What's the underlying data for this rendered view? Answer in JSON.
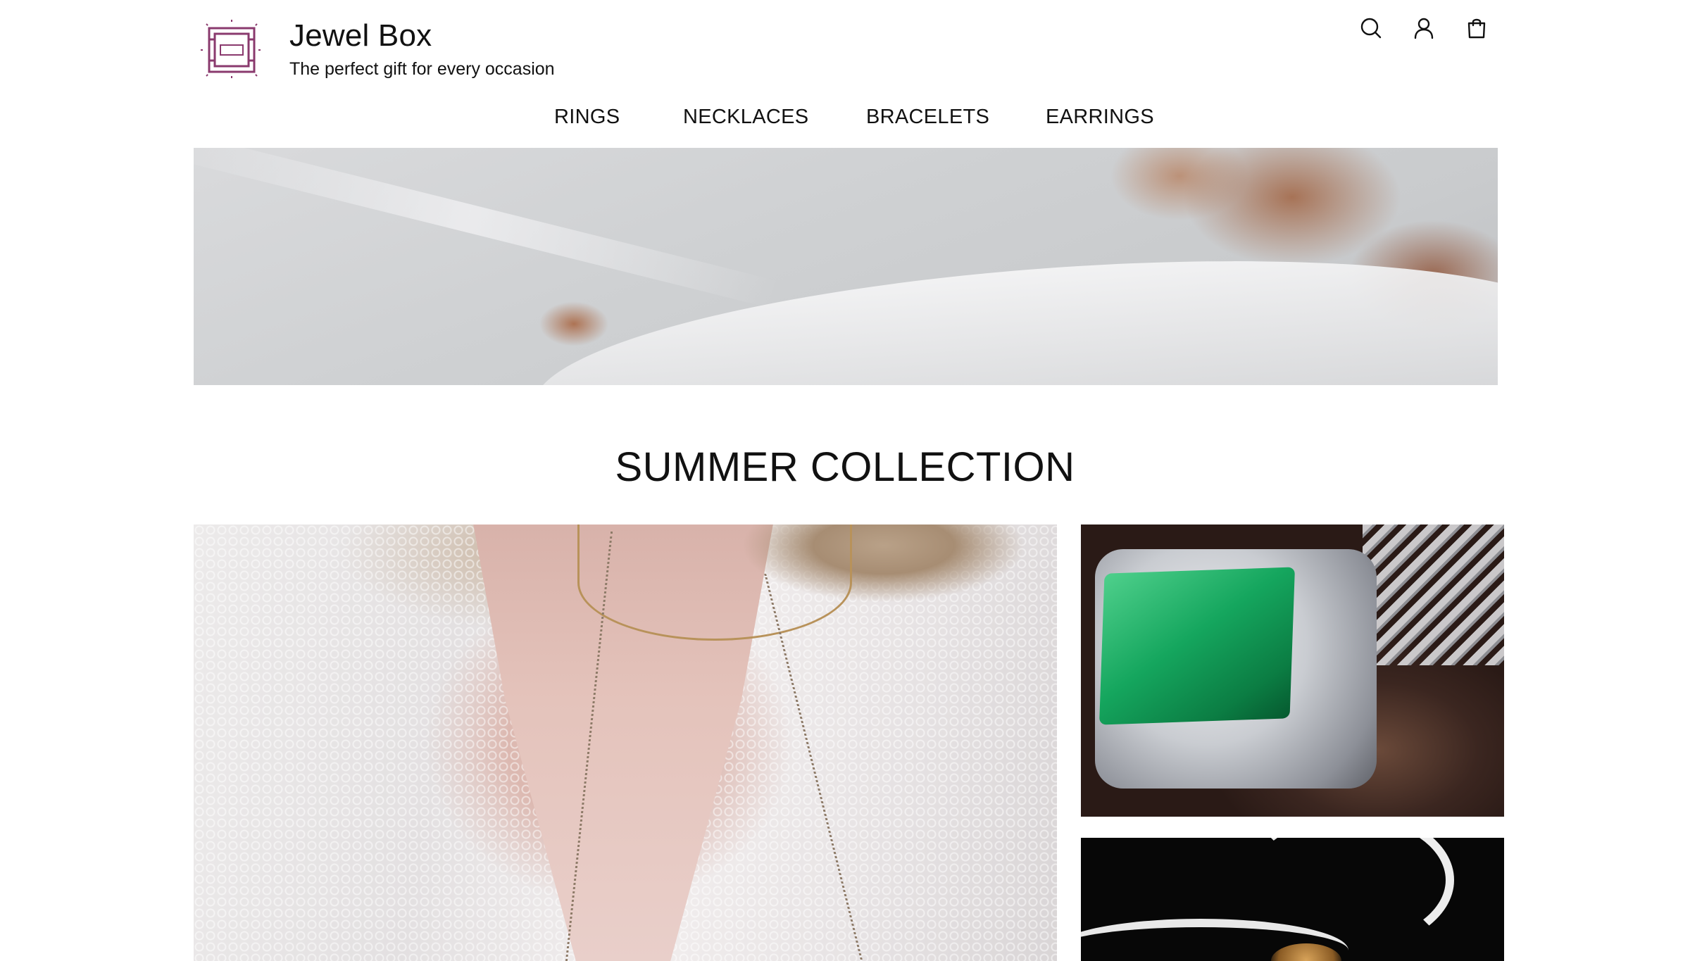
{
  "header": {
    "title": "Jewel Box",
    "tagline": "The perfect gift for every occasion",
    "logo_icon": "gem-icon",
    "accent_color": "#8a3a6e",
    "actions": [
      {
        "icon": "search-icon"
      },
      {
        "icon": "user-icon"
      },
      {
        "icon": "shopping-bag-icon"
      }
    ]
  },
  "nav": {
    "items": [
      {
        "label": "RINGS"
      },
      {
        "label": "NECKLACES"
      },
      {
        "label": "BRACELETS"
      },
      {
        "label": "EARRINGS"
      }
    ]
  },
  "main": {
    "section_title": "SUMMER COLLECTION"
  }
}
